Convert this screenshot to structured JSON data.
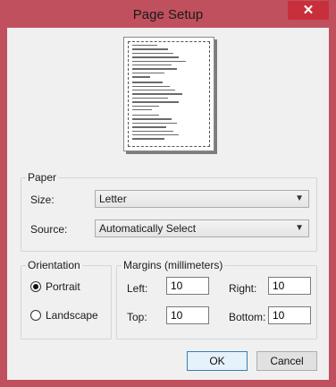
{
  "window": {
    "title": "Page Setup",
    "close_glyph": "✕"
  },
  "paper": {
    "legend": "Paper",
    "size_label": "Size:",
    "size_value": "Letter",
    "source_label": "Source:",
    "source_value": "Automatically Select"
  },
  "orientation": {
    "legend": "Orientation",
    "portrait_label": "Portrait",
    "landscape_label": "Landscape",
    "selected": "Portrait"
  },
  "margins": {
    "legend": "Margins (millimeters)",
    "left_label": "Left:",
    "left_value": "10",
    "right_label": "Right:",
    "right_value": "10",
    "top_label": "Top:",
    "top_value": "10",
    "bottom_label": "Bottom:",
    "bottom_value": "10"
  },
  "buttons": {
    "ok": "OK",
    "cancel": "Cancel"
  },
  "icons": {
    "close": "close-icon",
    "dropdown": "chevron-down-icon"
  }
}
